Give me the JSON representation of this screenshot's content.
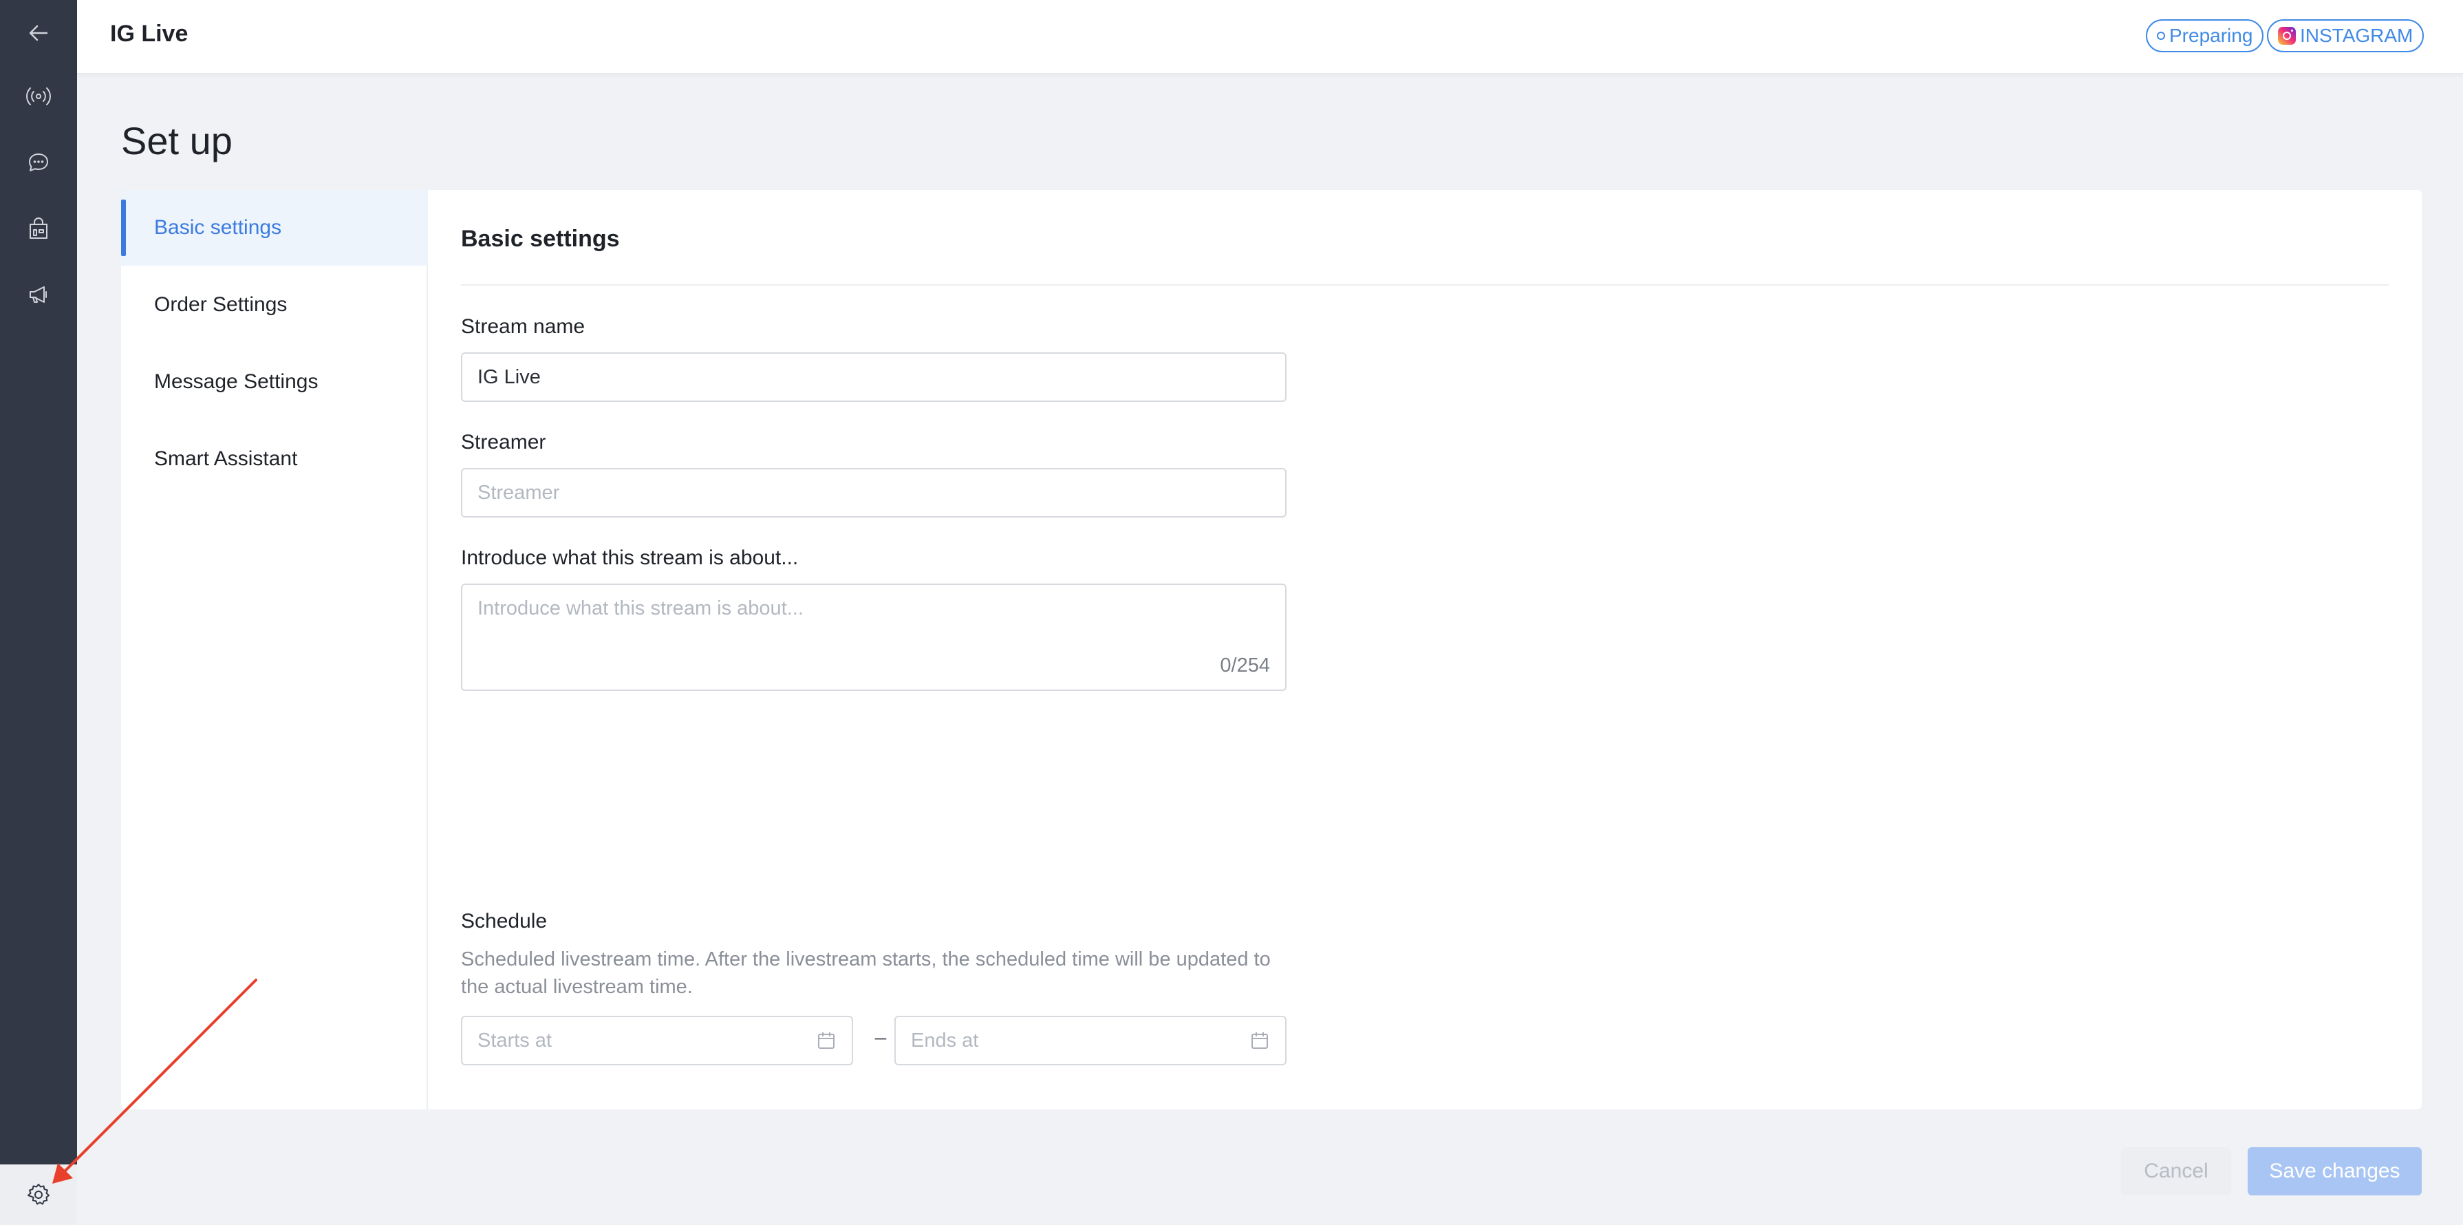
{
  "header": {
    "title": "IG Live",
    "status_tag": "Preparing",
    "platform_tag": "INSTAGRAM"
  },
  "rail": {
    "icons": [
      "back-arrow-icon",
      "broadcast-icon",
      "chat-bubble-icon",
      "store-icon",
      "megaphone-icon",
      "gear-icon"
    ]
  },
  "page": {
    "title": "Set up"
  },
  "side_menu": {
    "items": [
      {
        "label": "Basic settings",
        "active": true
      },
      {
        "label": "Order Settings",
        "active": false
      },
      {
        "label": "Message Settings",
        "active": false
      },
      {
        "label": "Smart Assistant",
        "active": false
      }
    ]
  },
  "form": {
    "section_title": "Basic settings",
    "stream_name": {
      "label": "Stream name",
      "value": "IG Live"
    },
    "streamer": {
      "label": "Streamer",
      "placeholder": "Streamer",
      "value": ""
    },
    "intro": {
      "label": "Introduce what this stream is about...",
      "placeholder": "Introduce what this stream is about...",
      "counter": "0/254"
    },
    "schedule": {
      "label": "Schedule",
      "help": "Scheduled livestream time. After the livestream starts, the scheduled time will be updated to the actual livestream time.",
      "starts_placeholder": "Starts at",
      "separator": "–",
      "ends_placeholder": "Ends at"
    }
  },
  "footer": {
    "cancel_label": "Cancel",
    "save_label": "Save changes"
  },
  "colors": {
    "accent": "#3b7be0",
    "rail_bg": "#323846",
    "annotation_arrow": "#e8402c"
  }
}
